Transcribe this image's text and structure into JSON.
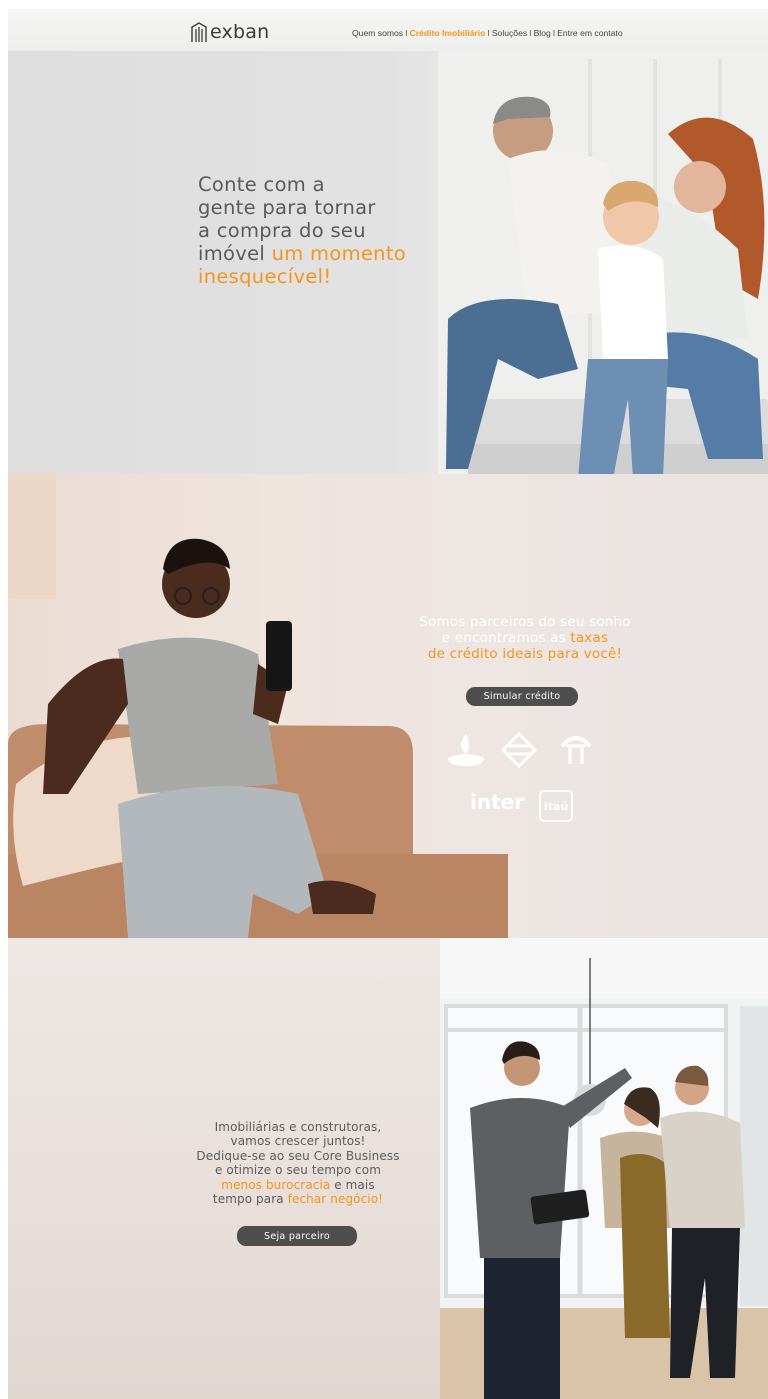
{
  "header": {
    "logo_text": "exban",
    "nav": [
      {
        "label": "Quem somos",
        "active": false
      },
      {
        "label": "Crédito Imobiliário",
        "active": true
      },
      {
        "label": "Soluções",
        "active": false
      },
      {
        "label": "Blog",
        "active": false
      },
      {
        "label": "Entre em contato",
        "active": false
      }
    ]
  },
  "hero": {
    "line1": "Conte com a",
    "line2": "gente para tornar",
    "line3": "a compra do seu",
    "line4_plain": "imóvel ",
    "line4_highlight": "um momento",
    "line5_highlight": "inesquecível!"
  },
  "partners": {
    "line1": "Somos parceiros do seu sonho",
    "line2_plain": "e encontramos as ",
    "line2_highlight": "taxas",
    "line3_highlight": "de crédito ideais para você!",
    "button_label": "Simular crédito",
    "banks": [
      "Santander",
      "Banco do Brasil",
      "Bradesco",
      "inter",
      "Itaú"
    ],
    "bank_inter": "inter",
    "bank_itau": "Itaú"
  },
  "agencies": {
    "line1": "Imobiliárias e construtoras,",
    "line2": "vamos crescer juntos!",
    "line3": "Dedique-se ao seu Core Business",
    "line4": "e otimize o seu tempo com",
    "line5_highlight": "menos burocracia",
    "line5_plain": " e mais",
    "line6_plain": "tempo para ",
    "line6_highlight": "fechar negócio!",
    "button_label": "Seja parceiro"
  },
  "colors": {
    "accent": "#f7941d",
    "button_bg": "#4e4e4e",
    "text_gray": "#5a5a5a"
  },
  "icons": [
    "building-logo-icon",
    "santander-flame-icon",
    "banco-do-brasil-icon",
    "bradesco-tree-icon"
  ]
}
